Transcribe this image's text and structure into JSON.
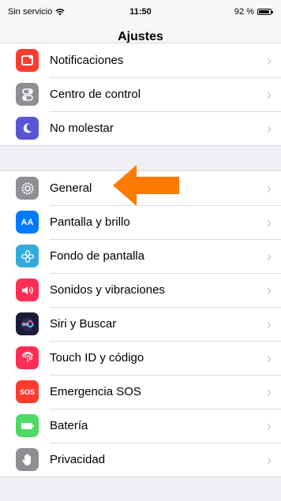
{
  "status_bar": {
    "carrier": "Sin servicio",
    "time": "11:50",
    "battery": "92 %",
    "battery_level": 0.92
  },
  "nav": {
    "title": "Ajustes"
  },
  "groups": [
    [
      {
        "label": "Notificaciones",
        "icon": "notifications-icon",
        "color": "#ff3b30"
      },
      {
        "label": "Centro de control",
        "icon": "control-center-icon",
        "color": "#8e8e93"
      },
      {
        "label": "No molestar",
        "icon": "moon-icon",
        "color": "#5856d6"
      }
    ],
    [
      {
        "label": "General",
        "icon": "gear-icon",
        "color": "#8e8e93"
      },
      {
        "label": "Pantalla y brillo",
        "icon": "display-icon",
        "color": "#007aff",
        "glyph": "AA"
      },
      {
        "label": "Fondo de pantalla",
        "icon": "wallpaper-icon",
        "color": "#34aadc"
      },
      {
        "label": "Sonidos y vibraciones",
        "icon": "speaker-icon",
        "color": "#ff2d55"
      },
      {
        "label": "Siri y Buscar",
        "icon": "siri-icon",
        "color": "#1c1c3a"
      },
      {
        "label": "Touch ID y código",
        "icon": "fingerprint-icon",
        "color": "#ff2d55"
      },
      {
        "label": "Emergencia SOS",
        "icon": "sos-icon",
        "color": "#ff3b30",
        "glyph": "SOS"
      },
      {
        "label": "Batería",
        "icon": "battery-icon",
        "color": "#4cd964"
      },
      {
        "label": "Privacidad",
        "icon": "hand-icon",
        "color": "#8e8e93"
      }
    ]
  ],
  "annotation": {
    "arrow_color": "#ff7a00",
    "icon": "arrow-left-icon"
  }
}
